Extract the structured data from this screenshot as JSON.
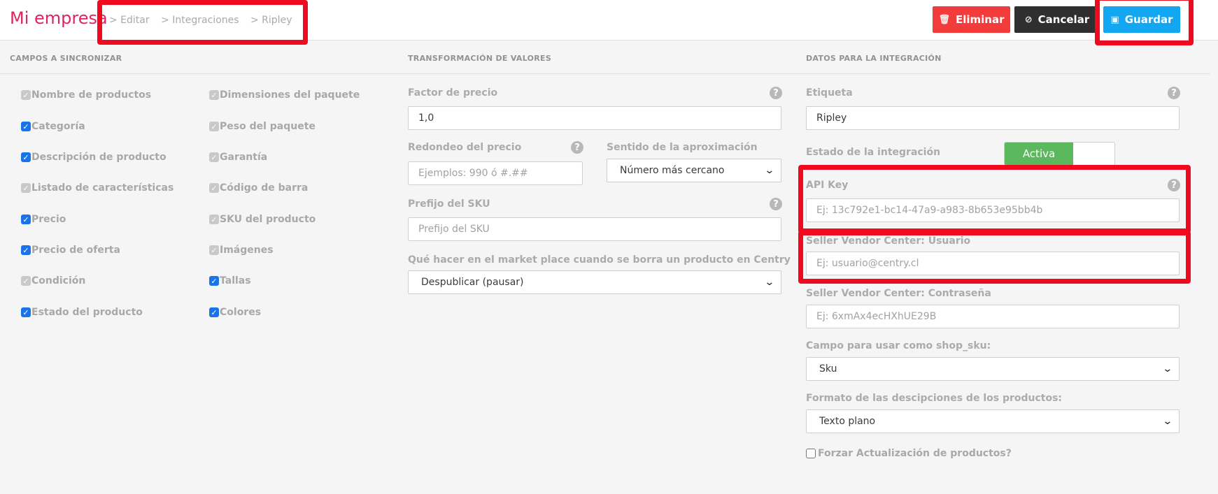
{
  "header": {
    "brand": "Mi empresa",
    "breadcrumbs": [
      "> Editar",
      "> Integraciones",
      "> Ripley"
    ],
    "buttons": {
      "delete": "Eliminar",
      "cancel": "Cancelar",
      "save": "Guardar"
    }
  },
  "sections": {
    "sync": "CAMPOS A SINCRONIZAR",
    "transform": "TRANSFORMACIÓN DE VALORES",
    "integration": "DATOS PARA LA INTEGRACIÓN"
  },
  "sync_fields": {
    "col1": [
      {
        "label": "Nombre de productos",
        "state": "disabled"
      },
      {
        "label": "Categoría",
        "state": "checked"
      },
      {
        "label": "Descripción de producto",
        "state": "checked"
      },
      {
        "label": "Listado de características",
        "state": "disabled"
      },
      {
        "label": "Precio",
        "state": "checked"
      },
      {
        "label": "Precio de oferta",
        "state": "checked"
      },
      {
        "label": "Condición",
        "state": "disabled"
      },
      {
        "label": "Estado del producto",
        "state": "checked"
      }
    ],
    "col2": [
      {
        "label": "Dimensiones del paquete",
        "state": "disabled"
      },
      {
        "label": "Peso del paquete",
        "state": "disabled"
      },
      {
        "label": "Garantía",
        "state": "disabled"
      },
      {
        "label": "Código de barra",
        "state": "disabled"
      },
      {
        "label": "SKU del producto",
        "state": "disabled"
      },
      {
        "label": "Imágenes",
        "state": "disabled"
      },
      {
        "label": "Tallas",
        "state": "checked"
      },
      {
        "label": "Colores",
        "state": "checked"
      }
    ]
  },
  "transform": {
    "price_factor": {
      "label": "Factor de precio",
      "value": "1,0"
    },
    "rounding": {
      "label": "Redondeo del precio",
      "placeholder": "Ejemplos: 990 ó #.##"
    },
    "approx": {
      "label": "Sentido de la aproximación",
      "value": "Número más cercano"
    },
    "sku_prefix": {
      "label": "Prefijo del SKU",
      "placeholder": "Prefijo del SKU"
    },
    "on_delete": {
      "label": "Qué hacer en el market place cuando se borra un producto en Centry",
      "value": "Despublicar (pausar)"
    }
  },
  "integration": {
    "tag": {
      "label": "Etiqueta",
      "value": "Ripley"
    },
    "status": {
      "label": "Estado de la integración",
      "value": "Activa"
    },
    "api_key": {
      "label": "API Key",
      "placeholder": "Ej: 13c792e1-bc14-47a9-a983-8b653e95bb4b"
    },
    "user": {
      "label": "Seller Vendor Center: Usuario",
      "placeholder": "Ej: usuario@centry.cl"
    },
    "password": {
      "label": "Seller Vendor Center: Contraseña",
      "placeholder": "Ej: 6xmAx4ecHXhUE29B"
    },
    "shop_sku": {
      "label": "Campo para usar como shop_sku:",
      "value": "Sku"
    },
    "desc_format": {
      "label": "Formato de las descipciones de los productos:",
      "value": "Texto plano"
    },
    "force_update": {
      "label": "Forzar Actualización de productos?",
      "checked": false
    }
  },
  "colors": {
    "brand": "#e0245e",
    "danger": "#f23c3c",
    "dark": "#2f2f2f",
    "primary": "#12a7f0",
    "active": "#5cb85c",
    "annotation": "#f00a1f"
  },
  "icons": {
    "delete": "trash-icon",
    "cancel": "ban-icon",
    "save": "floppy-disk-icon",
    "help": "question-circle-icon",
    "select": "chevron-down-icon"
  }
}
